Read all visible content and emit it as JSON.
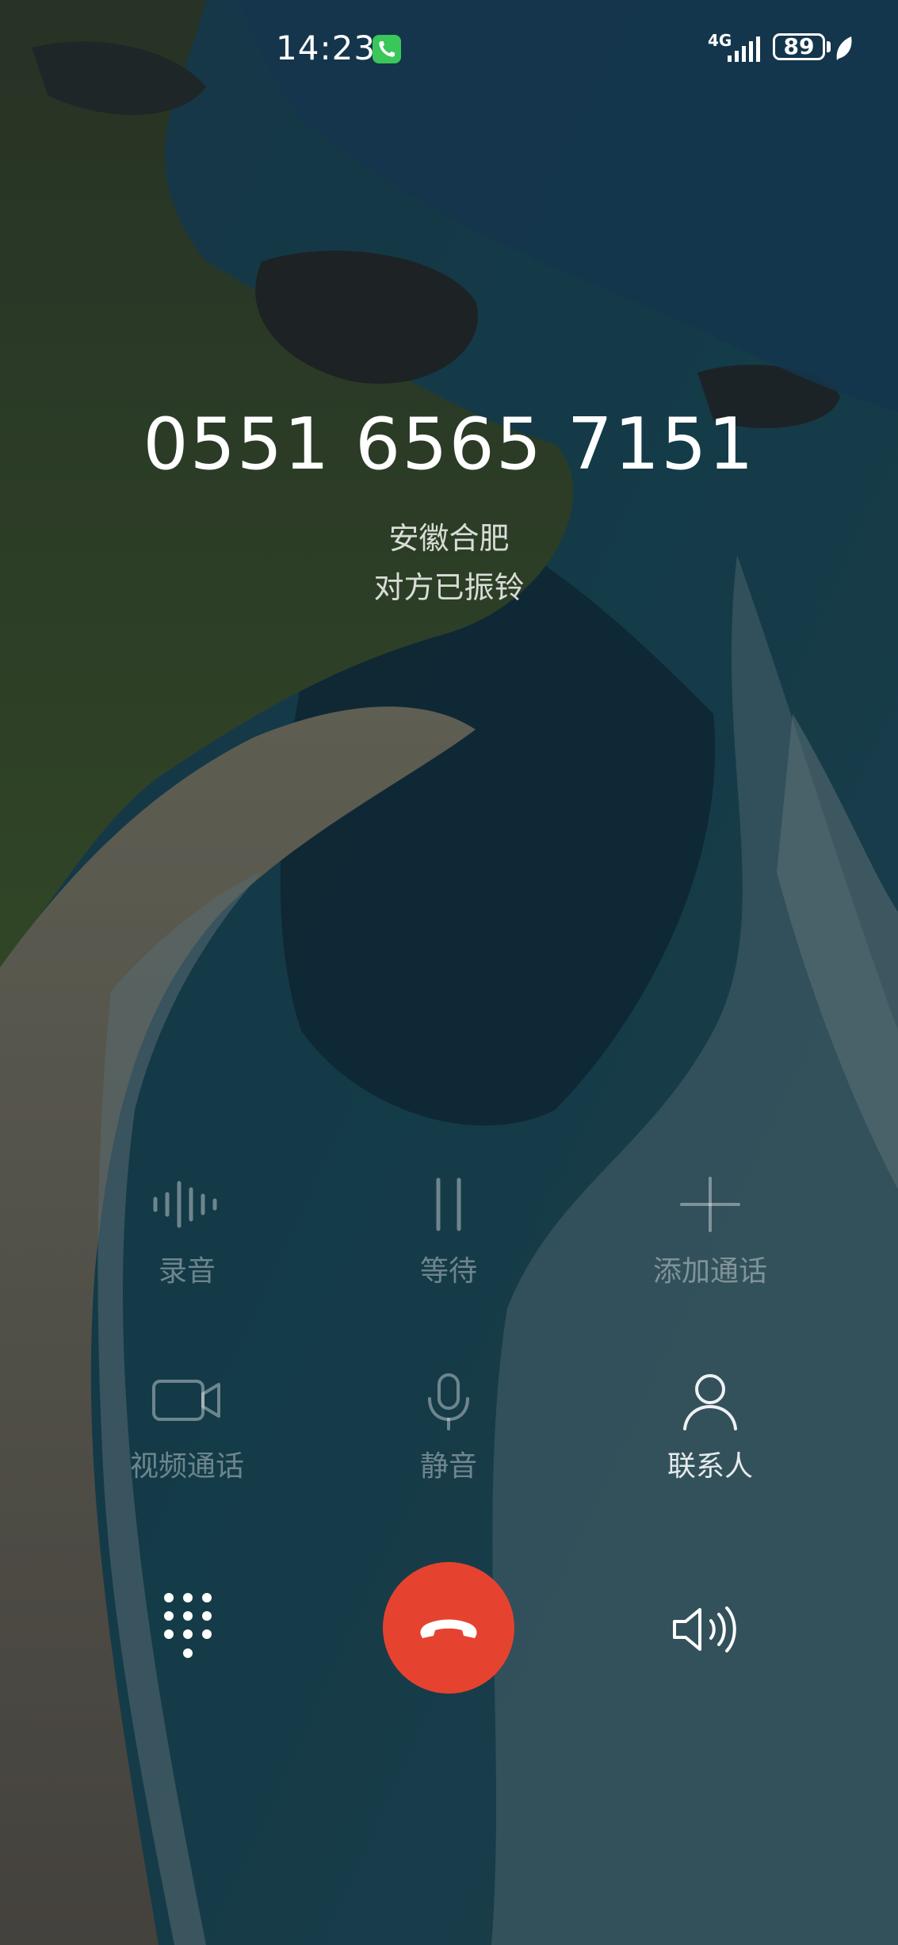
{
  "status_bar": {
    "time": "14:23",
    "network_type": "4G",
    "battery_level": "89",
    "icons": [
      "phone-call-indicator-icon",
      "signal-icon",
      "battery-icon",
      "leaf-icon"
    ]
  },
  "call": {
    "number": "0551 6565 7151",
    "location": "安徽合肥",
    "status": "对方已振铃"
  },
  "actions": {
    "record": {
      "label": "录音",
      "icon": "waveform-icon",
      "enabled": false
    },
    "hold": {
      "label": "等待",
      "icon": "pause-icon",
      "enabled": false
    },
    "add_call": {
      "label": "添加通话",
      "icon": "plus-icon",
      "enabled": false
    },
    "video_call": {
      "label": "视频通话",
      "icon": "video-camera-icon",
      "enabled": false
    },
    "mute": {
      "label": "静音",
      "icon": "microphone-icon",
      "enabled": false
    },
    "contacts": {
      "label": "联系人",
      "icon": "person-icon",
      "enabled": true
    }
  },
  "controls": {
    "keypad_icon": "dialpad-icon",
    "hangup_icon": "hang-up-icon",
    "speaker_icon": "speaker-icon"
  },
  "colors": {
    "hangup": "#e5432f",
    "call_indicator": "#3bc65a",
    "text_primary": "#ffffff"
  }
}
